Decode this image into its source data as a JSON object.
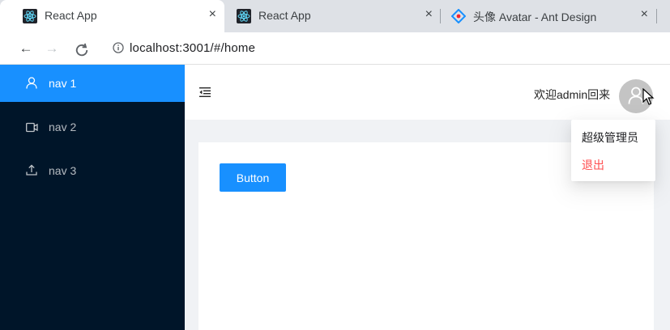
{
  "browser": {
    "tabs": [
      {
        "title": "React App",
        "favicon": "react-logo-icon",
        "active": true
      },
      {
        "title": "React App",
        "favicon": "react-logo-icon",
        "active": false
      },
      {
        "title": "头像 Avatar - Ant Design",
        "favicon": "ant-design-logo-icon",
        "active": false
      }
    ],
    "tab_close_glyph": "×",
    "url": "localhost:3001/#/home"
  },
  "app": {
    "menu": [
      {
        "label": "nav 1",
        "icon": "user-icon",
        "selected": true
      },
      {
        "label": "nav 2",
        "icon": "video-camera-icon",
        "selected": false
      },
      {
        "label": "nav 3",
        "icon": "upload-icon",
        "selected": false
      }
    ],
    "header": {
      "welcome_text": "欢迎admin回来",
      "avatar_icon": "user-icon"
    },
    "dropdown": {
      "items": [
        {
          "label": "超级管理员",
          "danger": false
        },
        {
          "label": "退出",
          "danger": true
        }
      ]
    },
    "content": {
      "button_label": "Button"
    }
  },
  "colors": {
    "primary": "#1890ff",
    "sider_bg": "#001529",
    "danger": "#ff4d4f",
    "layout_bg": "#f0f2f5"
  }
}
